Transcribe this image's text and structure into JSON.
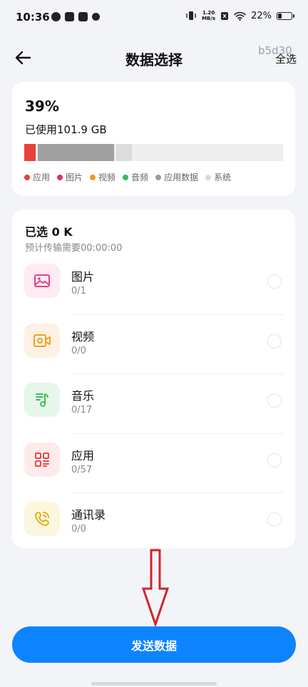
{
  "status_bar": {
    "time": "10:36",
    "speed_value": "1.20",
    "speed_unit": "MB/s",
    "battery": "22%",
    "icons": [
      "notification-icon",
      "tiktok-icon",
      "message-icon",
      "settings-icon",
      "vibrate-icon",
      "sim-icon",
      "wifi-icon",
      "battery-icon"
    ]
  },
  "header": {
    "title": "数据选择",
    "select_all": "全选",
    "watermark": "b5d30"
  },
  "storage": {
    "percent": "39%",
    "used_text": "已使用101.9 GB",
    "segments": [
      {
        "name": "应用",
        "color": "#e8413a",
        "fraction": 0.043
      },
      {
        "name": "应用数据",
        "color": "#a0a0a0",
        "fraction": 0.296
      },
      {
        "name": "系统",
        "color": "#dcdcdc",
        "fraction": 0.06
      }
    ],
    "legend": [
      {
        "label": "应用",
        "color": "#e8413a"
      },
      {
        "label": "图片",
        "color": "#e0306b"
      },
      {
        "label": "视频",
        "color": "#f09a1a"
      },
      {
        "label": "音频",
        "color": "#3dbb5c"
      },
      {
        "label": "应用数据",
        "color": "#9a9a9a"
      },
      {
        "label": "系统",
        "color": "#d9d9d9"
      }
    ]
  },
  "selection": {
    "selected": "已选 0 K",
    "estimate": "预计传输需要00:00:00",
    "categories": [
      {
        "name": "图片",
        "count": "0/1",
        "icon": "image-icon",
        "bg": "#fdeaf3",
        "fg": "#e0408a"
      },
      {
        "name": "视频",
        "count": "0/0",
        "icon": "video-icon",
        "bg": "#fdf1e3",
        "fg": "#f0a020"
      },
      {
        "name": "音乐",
        "count": "0/17",
        "icon": "music-icon",
        "bg": "#e7f6ea",
        "fg": "#3fbf5c"
      },
      {
        "name": "应用",
        "count": "0/57",
        "icon": "apps-icon",
        "bg": "#fdebeb",
        "fg": "#e84a4a"
      },
      {
        "name": "通讯录",
        "count": "0/0",
        "icon": "phone-icon",
        "bg": "#fcf6df",
        "fg": "#e0b020"
      }
    ]
  },
  "footer": {
    "send_label": "发送数据"
  },
  "colors": {
    "accent": "#0d84ff",
    "annotation": "#d0242a"
  }
}
